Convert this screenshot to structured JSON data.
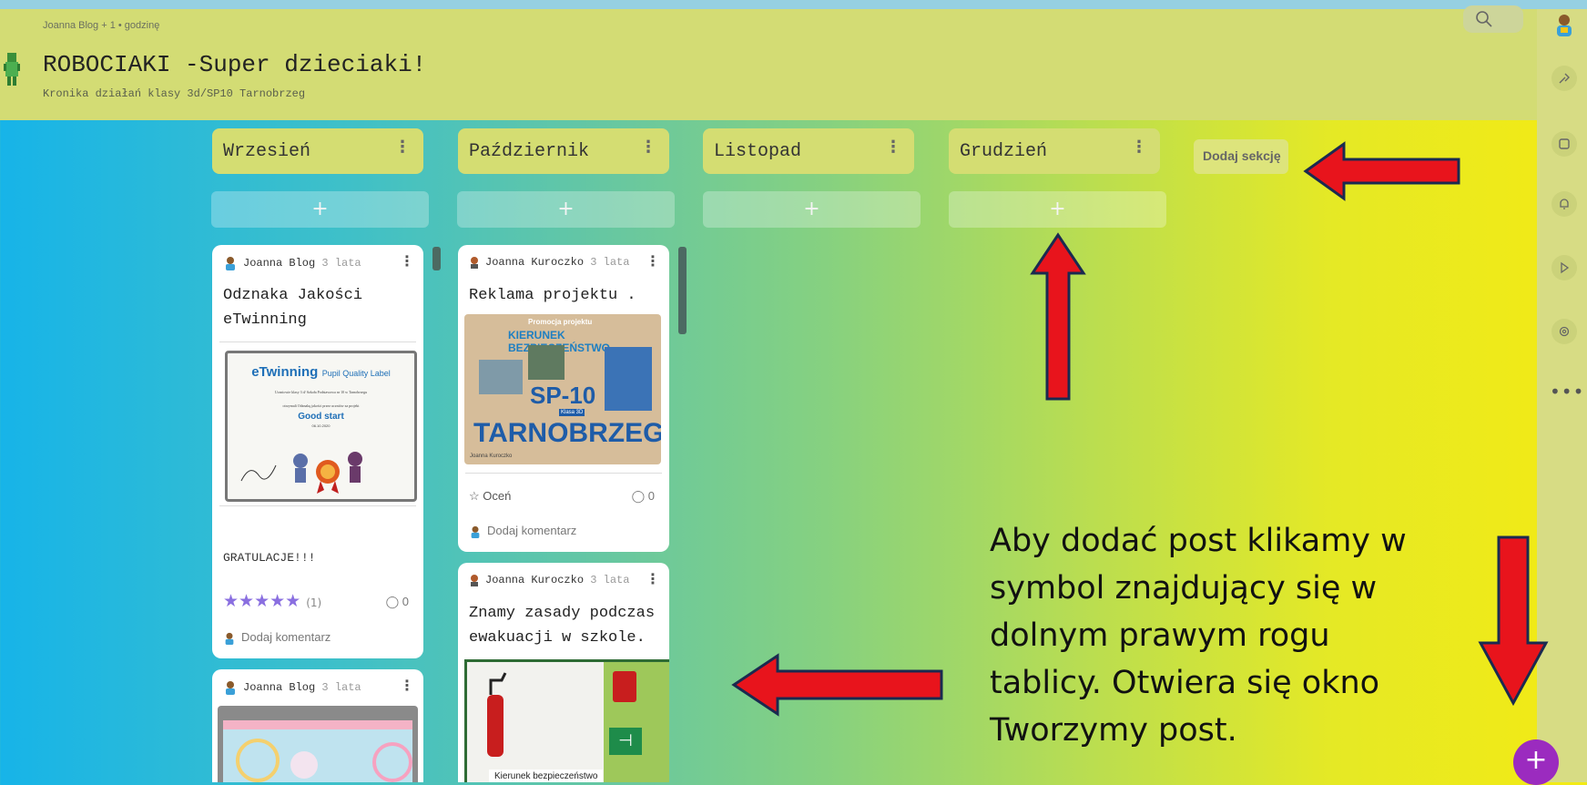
{
  "header": {
    "meta": "Joanna Blog + 1 • godzinę",
    "title": "ROBOCIAKI -Super dzieciaki!",
    "subtitle": "Kronika działań klasy 3d/SP10 Tarnobrzeg"
  },
  "columns": [
    {
      "name": "Wrzesień",
      "add_label": "+"
    },
    {
      "name": "Październik",
      "add_label": "+"
    },
    {
      "name": "Listopad",
      "add_label": "+"
    },
    {
      "name": "Grudzień",
      "add_label": "+"
    }
  ],
  "add_section_label": "Dodaj sekcję",
  "cards": {
    "c1": {
      "author": "Joanna Blog",
      "time": "3 lata",
      "title_line1": "Odznaka Jakości",
      "title_line2": "eTwinning",
      "image": {
        "brand": "eTwinning",
        "heading": "Pupil Quality Label",
        "line1": "Uczniowie klasy 3 d/ Szkoła Podstawowa nr 10 w Tarnobrzegu",
        "line2": "otrzymali Odznakę jakości przez uczniów za projekt",
        "project": "Good start",
        "date": "06.10.2020"
      },
      "text": "GRATULACJE!!!",
      "stars": "★★★★★",
      "rating_count": "(1)",
      "comment_count": "0",
      "comment_prompt": "Dodaj komentarz"
    },
    "c2": {
      "author": "Joanna Kuroczko",
      "time": "3 lata",
      "title": "Reklama projektu .",
      "image": {
        "top": "Promocja projektu",
        "banner": "KIERUNEK BEZPIECZEŃSTWO",
        "big1": "SP-10",
        "small": "Klasa 3D",
        "big2": "TARNOBRZEG",
        "credit": "Joanna Kuroczko"
      },
      "rate_label": "Oceń",
      "comment_count": "0",
      "comment_prompt": "Dodaj komentarz"
    },
    "c3": {
      "author": "Joanna Kuroczko",
      "time": "3 lata",
      "title_line1": "Znamy zasady podczas",
      "title_line2": "ewakuacji w szkole.",
      "image_caption": "Kierunek bezpieczeństwo"
    },
    "c4": {
      "author": "Joanna Blog",
      "time": "3 lata"
    }
  },
  "instruction_lines": [
    "Aby dodać post klikamy w",
    "symbol znajdujący się w",
    "dolnym prawym rogu",
    "tablicy. Otwiera się okno",
    "Tworzymy post."
  ],
  "fab_label": "+",
  "colors": {
    "header": "#d3dc74",
    "arrow": "#e8141c",
    "arrow_outline": "#1a2a50",
    "fab": "#9b2bbf"
  },
  "icons": [
    "search-icon",
    "share-icon",
    "copy-icon",
    "bell-icon",
    "play-icon",
    "settings-icon",
    "more-icon"
  ]
}
